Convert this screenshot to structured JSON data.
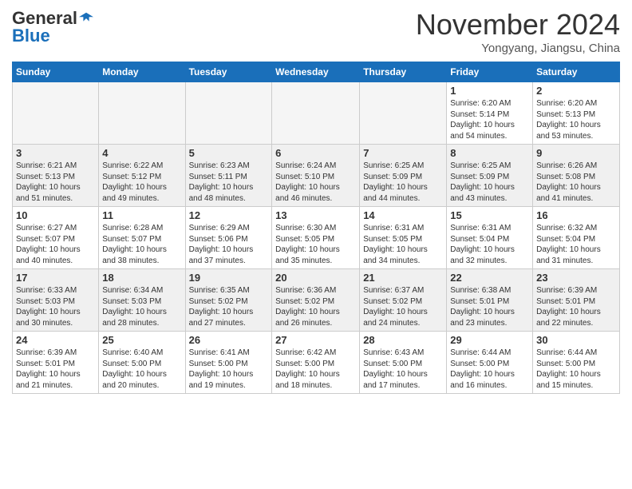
{
  "header": {
    "logo_general": "General",
    "logo_blue": "Blue",
    "month": "November 2024",
    "location": "Yongyang, Jiangsu, China"
  },
  "weekdays": [
    "Sunday",
    "Monday",
    "Tuesday",
    "Wednesday",
    "Thursday",
    "Friday",
    "Saturday"
  ],
  "weeks": [
    [
      {
        "day": "",
        "info": ""
      },
      {
        "day": "",
        "info": ""
      },
      {
        "day": "",
        "info": ""
      },
      {
        "day": "",
        "info": ""
      },
      {
        "day": "",
        "info": ""
      },
      {
        "day": "1",
        "info": "Sunrise: 6:20 AM\nSunset: 5:14 PM\nDaylight: 10 hours\nand 54 minutes."
      },
      {
        "day": "2",
        "info": "Sunrise: 6:20 AM\nSunset: 5:13 PM\nDaylight: 10 hours\nand 53 minutes."
      }
    ],
    [
      {
        "day": "3",
        "info": "Sunrise: 6:21 AM\nSunset: 5:13 PM\nDaylight: 10 hours\nand 51 minutes."
      },
      {
        "day": "4",
        "info": "Sunrise: 6:22 AM\nSunset: 5:12 PM\nDaylight: 10 hours\nand 49 minutes."
      },
      {
        "day": "5",
        "info": "Sunrise: 6:23 AM\nSunset: 5:11 PM\nDaylight: 10 hours\nand 48 minutes."
      },
      {
        "day": "6",
        "info": "Sunrise: 6:24 AM\nSunset: 5:10 PM\nDaylight: 10 hours\nand 46 minutes."
      },
      {
        "day": "7",
        "info": "Sunrise: 6:25 AM\nSunset: 5:09 PM\nDaylight: 10 hours\nand 44 minutes."
      },
      {
        "day": "8",
        "info": "Sunrise: 6:25 AM\nSunset: 5:09 PM\nDaylight: 10 hours\nand 43 minutes."
      },
      {
        "day": "9",
        "info": "Sunrise: 6:26 AM\nSunset: 5:08 PM\nDaylight: 10 hours\nand 41 minutes."
      }
    ],
    [
      {
        "day": "10",
        "info": "Sunrise: 6:27 AM\nSunset: 5:07 PM\nDaylight: 10 hours\nand 40 minutes."
      },
      {
        "day": "11",
        "info": "Sunrise: 6:28 AM\nSunset: 5:07 PM\nDaylight: 10 hours\nand 38 minutes."
      },
      {
        "day": "12",
        "info": "Sunrise: 6:29 AM\nSunset: 5:06 PM\nDaylight: 10 hours\nand 37 minutes."
      },
      {
        "day": "13",
        "info": "Sunrise: 6:30 AM\nSunset: 5:05 PM\nDaylight: 10 hours\nand 35 minutes."
      },
      {
        "day": "14",
        "info": "Sunrise: 6:31 AM\nSunset: 5:05 PM\nDaylight: 10 hours\nand 34 minutes."
      },
      {
        "day": "15",
        "info": "Sunrise: 6:31 AM\nSunset: 5:04 PM\nDaylight: 10 hours\nand 32 minutes."
      },
      {
        "day": "16",
        "info": "Sunrise: 6:32 AM\nSunset: 5:04 PM\nDaylight: 10 hours\nand 31 minutes."
      }
    ],
    [
      {
        "day": "17",
        "info": "Sunrise: 6:33 AM\nSunset: 5:03 PM\nDaylight: 10 hours\nand 30 minutes."
      },
      {
        "day": "18",
        "info": "Sunrise: 6:34 AM\nSunset: 5:03 PM\nDaylight: 10 hours\nand 28 minutes."
      },
      {
        "day": "19",
        "info": "Sunrise: 6:35 AM\nSunset: 5:02 PM\nDaylight: 10 hours\nand 27 minutes."
      },
      {
        "day": "20",
        "info": "Sunrise: 6:36 AM\nSunset: 5:02 PM\nDaylight: 10 hours\nand 26 minutes."
      },
      {
        "day": "21",
        "info": "Sunrise: 6:37 AM\nSunset: 5:02 PM\nDaylight: 10 hours\nand 24 minutes."
      },
      {
        "day": "22",
        "info": "Sunrise: 6:38 AM\nSunset: 5:01 PM\nDaylight: 10 hours\nand 23 minutes."
      },
      {
        "day": "23",
        "info": "Sunrise: 6:39 AM\nSunset: 5:01 PM\nDaylight: 10 hours\nand 22 minutes."
      }
    ],
    [
      {
        "day": "24",
        "info": "Sunrise: 6:39 AM\nSunset: 5:01 PM\nDaylight: 10 hours\nand 21 minutes."
      },
      {
        "day": "25",
        "info": "Sunrise: 6:40 AM\nSunset: 5:00 PM\nDaylight: 10 hours\nand 20 minutes."
      },
      {
        "day": "26",
        "info": "Sunrise: 6:41 AM\nSunset: 5:00 PM\nDaylight: 10 hours\nand 19 minutes."
      },
      {
        "day": "27",
        "info": "Sunrise: 6:42 AM\nSunset: 5:00 PM\nDaylight: 10 hours\nand 18 minutes."
      },
      {
        "day": "28",
        "info": "Sunrise: 6:43 AM\nSunset: 5:00 PM\nDaylight: 10 hours\nand 17 minutes."
      },
      {
        "day": "29",
        "info": "Sunrise: 6:44 AM\nSunset: 5:00 PM\nDaylight: 10 hours\nand 16 minutes."
      },
      {
        "day": "30",
        "info": "Sunrise: 6:44 AM\nSunset: 5:00 PM\nDaylight: 10 hours\nand 15 minutes."
      }
    ]
  ]
}
